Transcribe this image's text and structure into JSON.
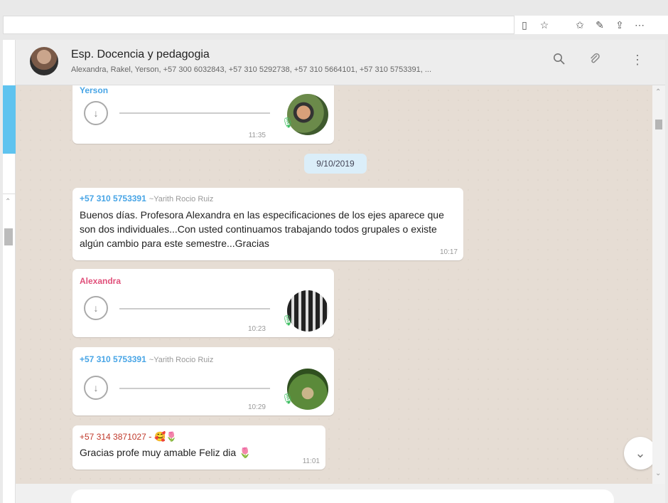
{
  "browser": {
    "icons": [
      "reading-view",
      "favorite-star",
      "favorites-list",
      "pen",
      "share",
      "more"
    ]
  },
  "chat": {
    "title": "Esp. Docencia y pedagogia",
    "members": "Alexandra, Rakel, Yerson, +57 300 6032843, +57 310 5292738, +57 310 5664101, +57 310 5753391, ..."
  },
  "messages": [
    {
      "sender": "Yerson",
      "sender_color": "#48a5e6",
      "type": "audio",
      "time": "11:35"
    },
    {
      "sender": "+57 310 5753391",
      "sender_name": "~Yarith Rocio Ruiz",
      "sender_color": "#48a5e6",
      "type": "text",
      "text": "Buenos días. Profesora Alexandra en las especificaciones de los ejes aparece que son dos individuales...Con usted continuamos trabajando todos grupales o existe algún cambio para este semestre...Gracias",
      "time": "10:17"
    },
    {
      "sender": "Alexandra",
      "sender_color": "#e0507a",
      "type": "audio",
      "time": "10:23"
    },
    {
      "sender": "+57 310 5753391",
      "sender_name": "~Yarith Rocio Ruiz",
      "sender_color": "#48a5e6",
      "type": "audio",
      "time": "10:29"
    },
    {
      "sender": "+57 314 3871027",
      "sender_color": "#c0392b",
      "type": "text",
      "text": "Gracias profe muy amable Feliz dia",
      "time": "11:01"
    }
  ],
  "date_divider": "9/10/2019"
}
